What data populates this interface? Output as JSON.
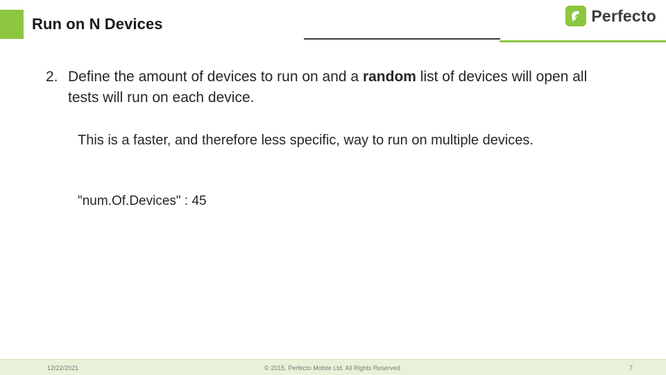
{
  "slide": {
    "title": "Run on N Devices",
    "logo": {
      "mark_icon": "perfecto-leaf-icon",
      "text": "Perfecto",
      "brand_color": "#8dc63f"
    },
    "content": {
      "bullet": {
        "number": "2.",
        "text_before": "Define the amount of devices to run on and a ",
        "emphasis": "random",
        "text_after": " list of devices will open all tests will run on each device."
      },
      "paragraph_1": "This is a faster, and therefore less specific, way to run on multiple devices.",
      "paragraph_2": "\"num.Of.Devices\" : 45"
    },
    "footer": {
      "date": "12/22/2021",
      "copyright": "© 2015, Perfecto Mobile Ltd. All Rights Reserved.",
      "page_number": "7"
    }
  }
}
